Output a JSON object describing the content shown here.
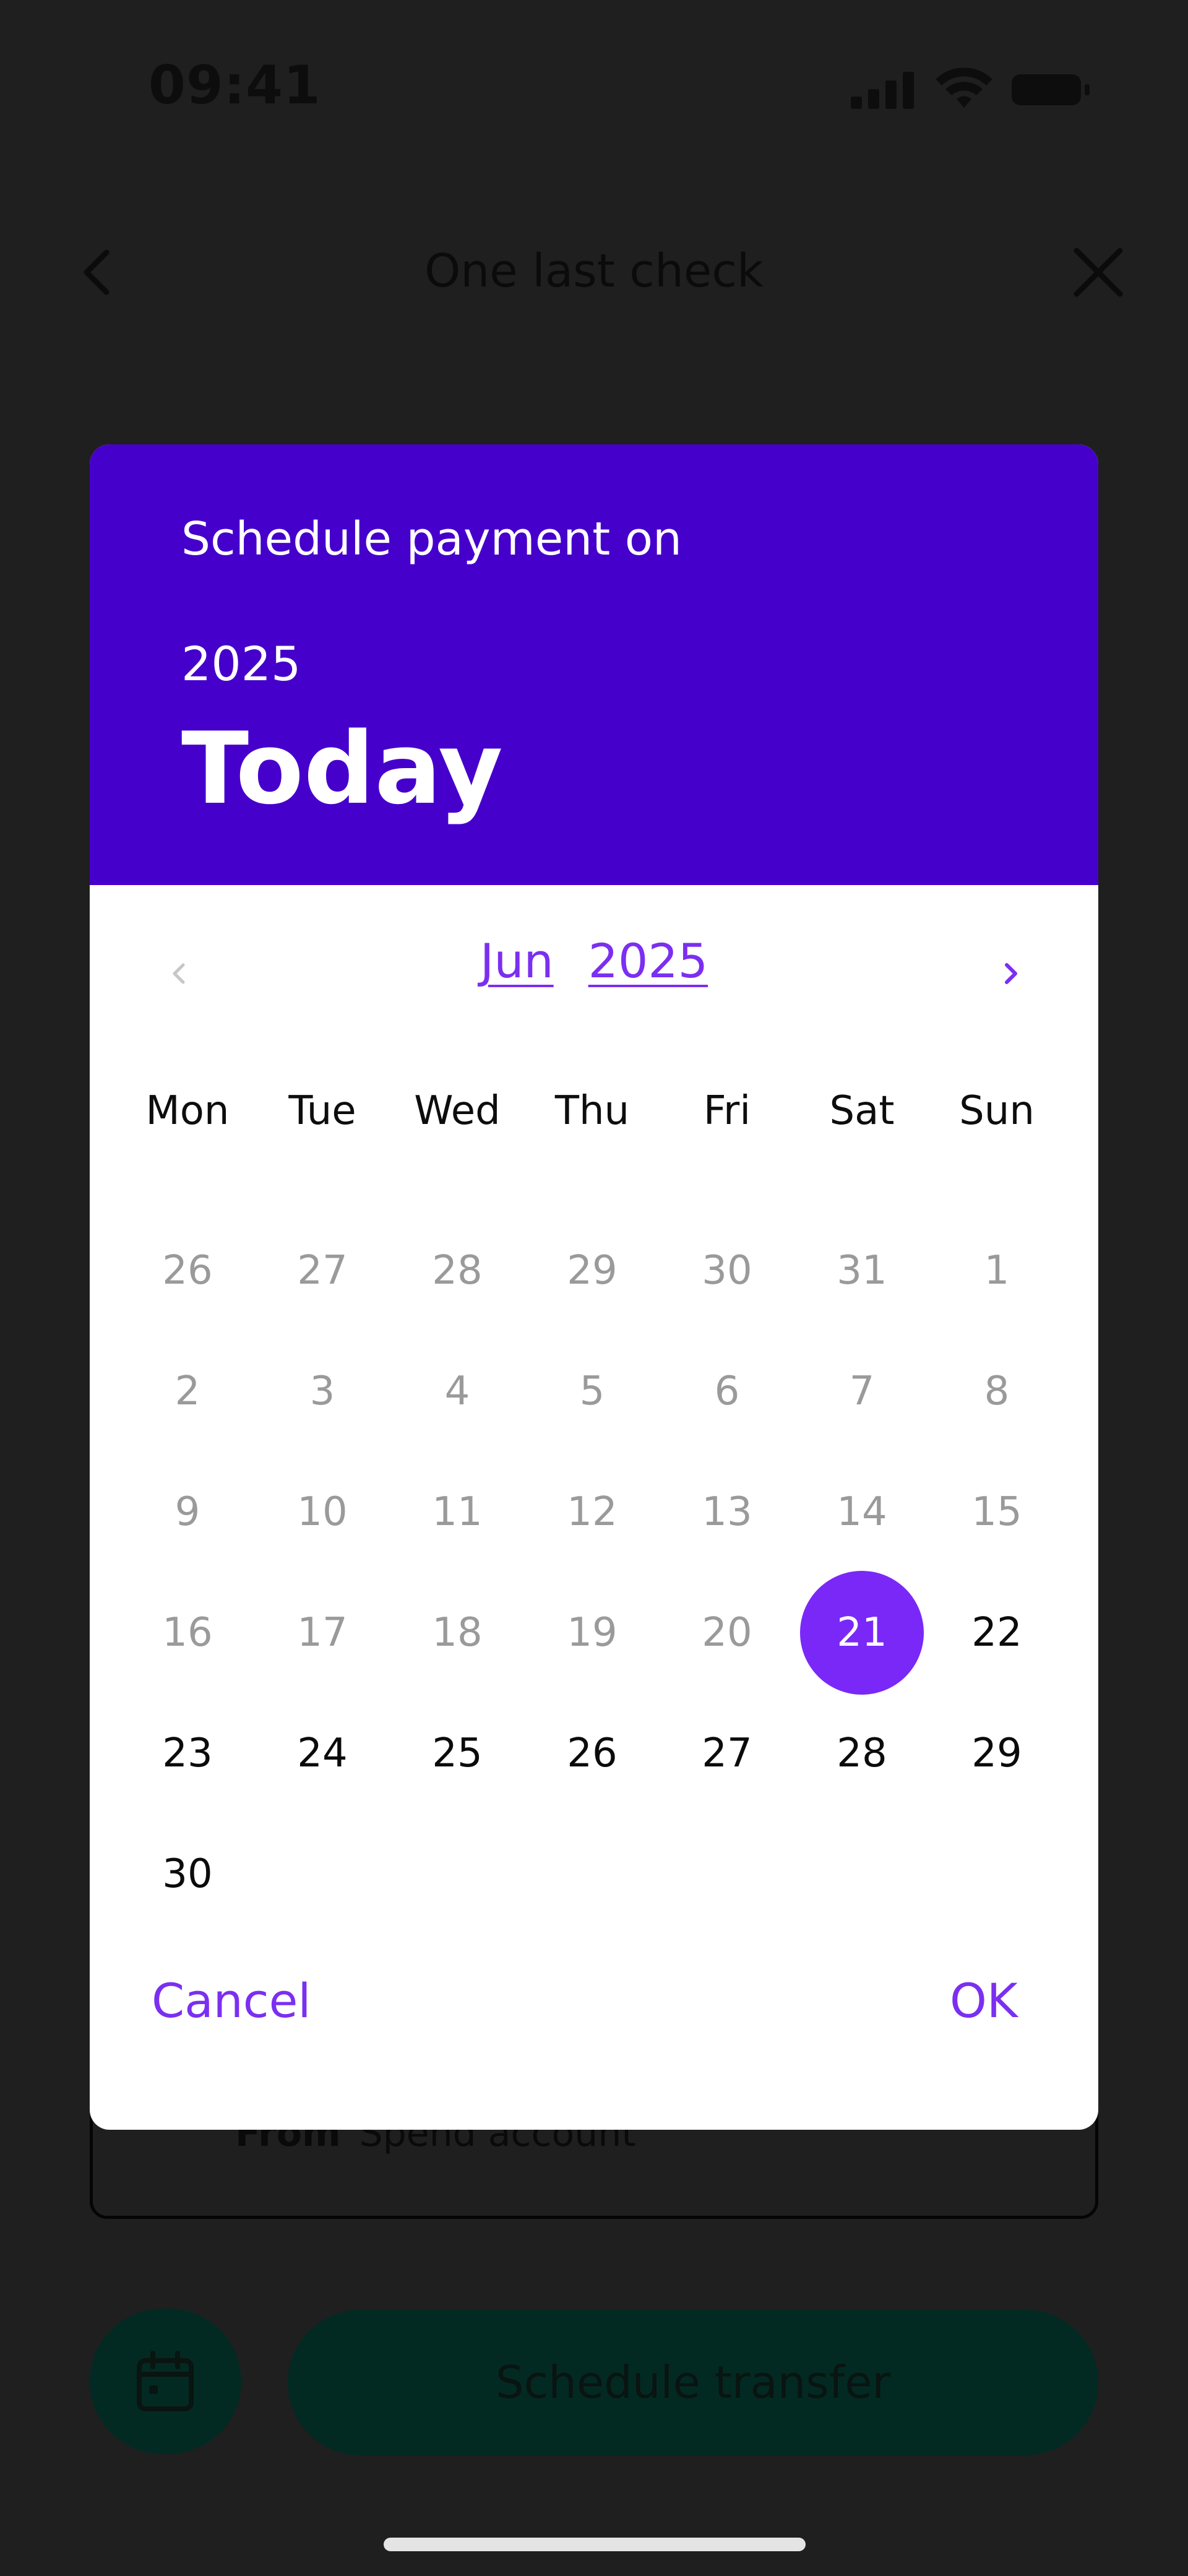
{
  "status_bar": {
    "time": "09:41"
  },
  "header": {
    "title": "One last check"
  },
  "from_card": {
    "label": "From",
    "value": "Spend account"
  },
  "footer": {
    "schedule_label": "Schedule transfer"
  },
  "dialog": {
    "subtitle": "Schedule payment on",
    "year": "2025",
    "selected_label": "Today",
    "month": "Jun",
    "nav_year": "2025",
    "weekdays": [
      "Mon",
      "Tue",
      "Wed",
      "Thu",
      "Fri",
      "Sat",
      "Sun"
    ],
    "weeks": [
      [
        "26",
        "27",
        "28",
        "29",
        "30",
        "31",
        "1"
      ],
      [
        "2",
        "3",
        "4",
        "5",
        "6",
        "7",
        "8"
      ],
      [
        "9",
        "10",
        "11",
        "12",
        "13",
        "14",
        "15"
      ],
      [
        "16",
        "17",
        "18",
        "19",
        "20",
        "21",
        "22"
      ],
      [
        "23",
        "24",
        "25",
        "26",
        "27",
        "28",
        "29"
      ],
      [
        "30",
        "",
        "",
        "",
        "",
        "",
        ""
      ]
    ],
    "selected_day": "21",
    "cancel_label": "Cancel",
    "ok_label": "OK"
  },
  "colors": {
    "header_bg": "#4600CC",
    "accent": "#7A28F8",
    "overlay": "#1F1F1F",
    "button_dark": "#022A23"
  }
}
